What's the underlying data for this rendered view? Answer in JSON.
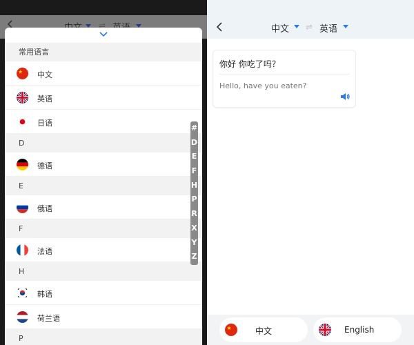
{
  "left": {
    "header": {
      "source_lang": "中文",
      "target_lang": "英语",
      "swap_icon": "⇌"
    },
    "sections": [
      {
        "header": "常用语言",
        "items": [
          {
            "label": "中文",
            "flag": "cn"
          },
          {
            "label": "英语",
            "flag": "gb"
          },
          {
            "label": "日语",
            "flag": "jp"
          }
        ]
      },
      {
        "header": "D",
        "items": [
          {
            "label": "德语",
            "flag": "de"
          }
        ]
      },
      {
        "header": "E",
        "items": [
          {
            "label": "俄语",
            "flag": "ru"
          }
        ]
      },
      {
        "header": "F",
        "items": [
          {
            "label": "法语",
            "flag": "fr"
          }
        ]
      },
      {
        "header": "H",
        "items": [
          {
            "label": "韩语",
            "flag": "kr"
          },
          {
            "label": "荷兰语",
            "flag": "nl"
          }
        ]
      },
      {
        "header": "P",
        "items": []
      }
    ],
    "index_letters": [
      "#",
      "D",
      "E",
      "F",
      "H",
      "P",
      "R",
      "X",
      "Y",
      "Z"
    ]
  },
  "right": {
    "header": {
      "source_lang": "中文",
      "target_lang": "英语",
      "swap_icon": "⇌"
    },
    "card": {
      "source_text": "你好 你吃了吗？",
      "translated_text": "Hello, have you eaten?"
    },
    "bottom": {
      "left_lang": "中文",
      "right_lang": "English"
    }
  },
  "colors": {
    "accent": "#2b7be4",
    "overlay": "#7c7c7c"
  }
}
